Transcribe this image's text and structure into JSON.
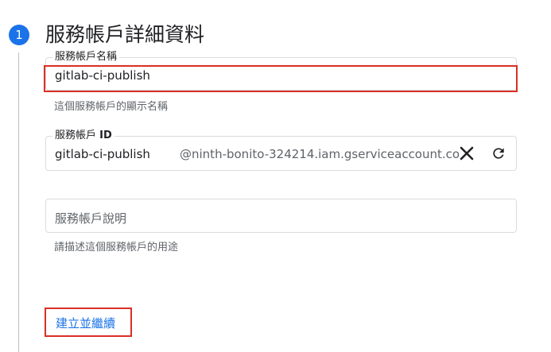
{
  "step": {
    "number": "1",
    "title": "服務帳戶詳細資料"
  },
  "name_field": {
    "label": "服務帳戶名稱",
    "value": "gitlab-ci-publish",
    "hint": "這個服務帳戶的顯示名稱"
  },
  "id_field": {
    "label_prefix": "服務帳戶 ",
    "label_id": "ID",
    "value": "gitlab-ci-publish",
    "suffix": "@ninth-bonito-324214.iam.gserviceaccount.co",
    "clear_icon": "close-icon",
    "refresh_icon": "refresh-icon"
  },
  "description_field": {
    "placeholder": "服務帳戶說明",
    "hint": "請描述這個服務帳戶的用途"
  },
  "actions": {
    "create_continue": "建立並繼續"
  },
  "colors": {
    "accent": "#1a73e8",
    "highlight": "#d93025"
  }
}
